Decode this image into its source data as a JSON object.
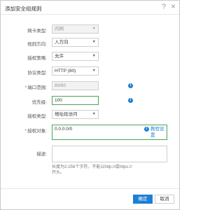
{
  "dialog": {
    "title": "添加安全组规则",
    "help_symbol": "?",
    "close_symbol": "×"
  },
  "form": {
    "nic_type": {
      "label": "网卡类型:",
      "value": "内网"
    },
    "direction": {
      "label": "规则方向:",
      "value": "入方向"
    },
    "policy": {
      "label": "授权策略:",
      "value": "允许"
    },
    "protocol": {
      "label": "协议类型:",
      "value": "HTTP (80)"
    },
    "port_range": {
      "label": "端口范围:",
      "value": "80/80",
      "required_mark": "*"
    },
    "priority": {
      "label": "优先级:",
      "value": "100"
    },
    "auth_type": {
      "label": "授权类型:",
      "value": "地址段访问"
    },
    "auth_object": {
      "label": "授权对象:",
      "value": "0.0.0.0/0",
      "required_mark": "*",
      "tutorial_link_line1": "教程",
      "tutorial_link_line2_a": "设",
      "tutorial_link_line2_b": "置"
    },
    "description": {
      "label": "描述:",
      "value": "",
      "hint_line1": "长度为2-256个字符，不能以http://或https://",
      "hint_line2": "开头。"
    }
  },
  "footer": {
    "confirm_label": "确定",
    "cancel_label": "取消"
  },
  "colors": {
    "accent": "#1e7fd6",
    "required": "#e0453b",
    "focus_border": "#4aa454"
  },
  "icons": {
    "info": "info-icon",
    "dropdown": "chevron-down-icon",
    "help": "question-icon",
    "close": "close-icon"
  }
}
